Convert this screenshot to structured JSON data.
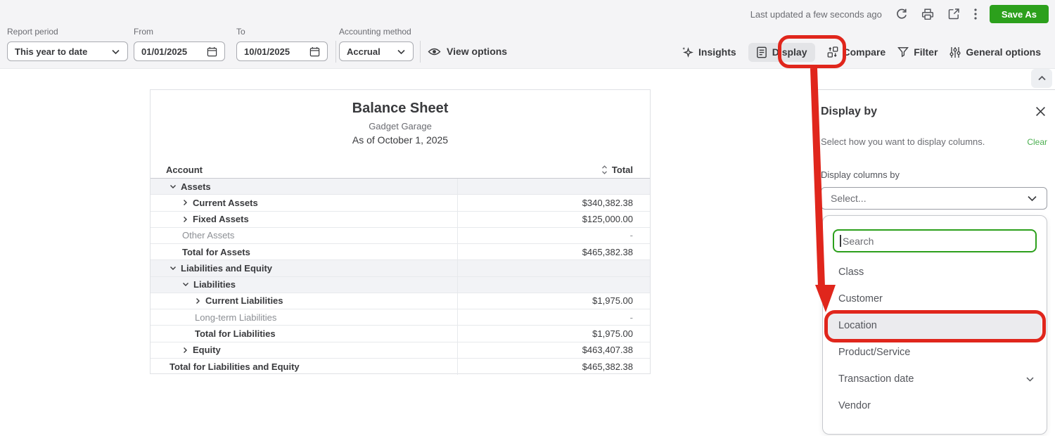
{
  "topbar": {
    "last_updated": "Last updated a few seconds ago",
    "save_as_label": "Save As",
    "filters": {
      "report_period": {
        "label": "Report period",
        "value": "This year to date"
      },
      "from": {
        "label": "From",
        "value": "01/01/2025"
      },
      "to": {
        "label": "To",
        "value": "10/01/2025"
      },
      "accounting_method": {
        "label": "Accounting method",
        "value": "Accrual"
      },
      "view_options_label": "View options"
    },
    "toolbar": {
      "insights": "Insights",
      "display": "Display",
      "compare": "Compare",
      "filter": "Filter",
      "general_options": "General options"
    }
  },
  "report": {
    "title": "Balance Sheet",
    "company": "Gadget Garage",
    "as_of": "As of October 1, 2025",
    "columns": {
      "account": "Account",
      "total": "Total"
    },
    "rows": [
      {
        "account": "Assets",
        "total": "",
        "type": "section"
      },
      {
        "account": "Current Assets",
        "total": "$340,382.38",
        "type": "item"
      },
      {
        "account": "Fixed Assets",
        "total": "$125,000.00",
        "type": "item"
      },
      {
        "account": "Other Assets",
        "total": "-",
        "type": "muted"
      },
      {
        "account": "Total for Assets",
        "total": "$465,382.38",
        "type": "total"
      },
      {
        "account": "Liabilities and Equity",
        "total": "",
        "type": "section"
      },
      {
        "account": "Liabilities",
        "total": "",
        "type": "section"
      },
      {
        "account": "Current Liabilities",
        "total": "$1,975.00",
        "type": "item"
      },
      {
        "account": "Long-term Liabilities",
        "total": "-",
        "type": "muted"
      },
      {
        "account": "Total for Liabilities",
        "total": "$1,975.00",
        "type": "total"
      },
      {
        "account": "Equity",
        "total": "$463,407.38",
        "type": "item"
      },
      {
        "account": "Total for Liabilities and Equity",
        "total": "$465,382.38",
        "type": "total"
      }
    ]
  },
  "panel": {
    "title": "Display by",
    "subtitle": "Select how you want to display columns.",
    "clear_label": "Clear",
    "field_label": "Display columns by",
    "select_placeholder": "Select...",
    "search_placeholder": "Search",
    "options": [
      {
        "label": "Class"
      },
      {
        "label": "Customer"
      },
      {
        "label": "Location",
        "highlighted": true
      },
      {
        "label": "Product/Service"
      },
      {
        "label": "Transaction date",
        "expandable": true
      },
      {
        "label": "Vendor"
      }
    ]
  },
  "icons": {
    "refresh": "refresh-icon",
    "print": "printer-icon",
    "export": "export-icon",
    "more": "kebab-menu-icon",
    "calendar": "calendar-icon",
    "eye": "eye-icon",
    "insights": "sparkle-icon",
    "display": "document-icon",
    "compare": "compare-icon",
    "filter": "funnel-icon",
    "general_options": "sliders-icon",
    "sort": "sort-icon",
    "close": "close-icon",
    "collapse": "chevron-up-icon"
  },
  "colors": {
    "brand_green": "#2ca01c",
    "annotation_red": "#e0261c",
    "selected_pill_bg": "#e3e4e7",
    "section_row_bg": "#f2f3f6"
  }
}
